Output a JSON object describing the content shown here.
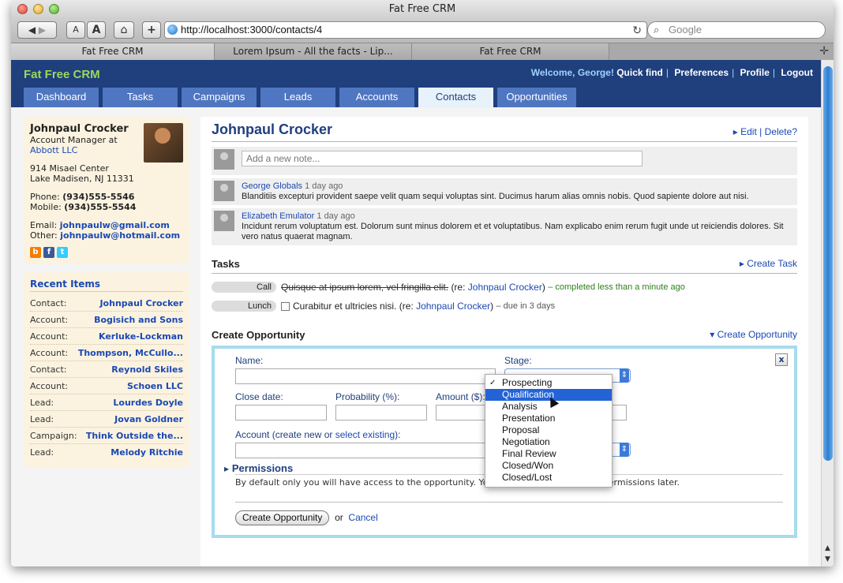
{
  "window": {
    "title": "Fat Free CRM"
  },
  "toolbar": {
    "text_smaller": "A",
    "text_bigger": "A",
    "home": "⌂",
    "add": "+",
    "url": "http://localhost:3000/contacts/4",
    "search_placeholder": "Google"
  },
  "browser_tabs": [
    {
      "label": "Fat Free CRM"
    },
    {
      "label": "Lorem Ipsum - All the facts - Lip..."
    },
    {
      "label": "Fat Free CRM"
    }
  ],
  "app": {
    "brand": "Fat Free CRM",
    "welcome": "Welcome, George!",
    "nav": [
      "Quick find",
      "Preferences",
      "Profile",
      "Logout"
    ],
    "tabs": [
      "Dashboard",
      "Tasks",
      "Campaigns",
      "Leads",
      "Accounts",
      "Contacts",
      "Opportunities"
    ]
  },
  "contact_card": {
    "name": "Johnpaul Crocker",
    "title": "Account Manager at",
    "company": "Abbott LLC",
    "address1": "914 Misael Center",
    "address2": "Lake Madisen, NJ 11331",
    "phone_label": "Phone:",
    "phone": "(934)555-5546",
    "mobile_label": "Mobile:",
    "mobile": "(934)555-5544",
    "email_label": "Email:",
    "email": "johnpaulw@gmail.com",
    "other_label": "Other:",
    "other_email": "johnpaulw@hotmail.com"
  },
  "recent_items": {
    "title": "Recent Items",
    "rows": [
      {
        "type": "Contact:",
        "name": "Johnpaul Crocker"
      },
      {
        "type": "Account:",
        "name": "Bogisich and Sons"
      },
      {
        "type": "Account:",
        "name": "Kerluke-Lockman"
      },
      {
        "type": "Account:",
        "name": "Thompson, McCullo..."
      },
      {
        "type": "Contact:",
        "name": "Reynold Skiles"
      },
      {
        "type": "Account:",
        "name": "Schoen LLC"
      },
      {
        "type": "Lead:",
        "name": "Lourdes Doyle"
      },
      {
        "type": "Lead:",
        "name": "Jovan Goldner"
      },
      {
        "type": "Campaign:",
        "name": "Think Outside the..."
      },
      {
        "type": "Lead:",
        "name": "Melody Ritchie"
      }
    ]
  },
  "main": {
    "title": "Johnpaul Crocker",
    "edit": "Edit",
    "delete": "Delete?",
    "note_placeholder": "Add a new note...",
    "notes": [
      {
        "author": "George Globals",
        "when": "1 day ago",
        "text": "Blanditiis excepturi provident saepe velit quam sequi voluptas sint. Ducimus harum alias omnis nobis. Quod sapiente dolore aut nisi."
      },
      {
        "author": "Elizabeth Emulator",
        "when": "1 day ago",
        "text": "Incidunt rerum voluptatum est. Dolorum sunt minus dolorem et et voluptatibus. Nam explicabo enim rerum fugit unde ut reiciendis dolores. Sit vero natus quaerat magnam."
      }
    ],
    "tasks_title": "Tasks",
    "create_task": "Create Task",
    "tasks": [
      {
        "category": "Call",
        "text": "Quisque at ipsum lorem, vel fringilla elit.",
        "re_label": "(re:",
        "re": "Johnpaul Crocker",
        "status": "– completed less than a minute ago"
      },
      {
        "category": "Lunch",
        "text": "Curabitur et ultricies nisi.",
        "re_label": "(re:",
        "re": "Johnpaul Crocker",
        "status": "– due in 3 days"
      }
    ],
    "opp_title": "Create Opportunity",
    "opp_toggle": "Create Opportunity",
    "form": {
      "name_label": "Name:",
      "stage_label": "Stage:",
      "close_label": "Close date:",
      "prob_label": "Probability (%):",
      "amount_label": "Amount ($):",
      "account_label": "Account (create new or",
      "select_existing": "select existing",
      "account_suffix": "):",
      "close_x": "x",
      "permissions": "Permissions",
      "permissions_text": "By default only you will have access to the opportunity. You can change opportunity permissions later.",
      "submit": "Create Opportunity",
      "or": "or",
      "cancel": "Cancel"
    },
    "stage_options": [
      "Prospecting",
      "Qualification",
      "Analysis",
      "Presentation",
      "Proposal",
      "Negotiation",
      "Final Review",
      "Closed/Won",
      "Closed/Lost"
    ],
    "stage_checked": "Prospecting",
    "stage_highlighted": "Qualification"
  }
}
